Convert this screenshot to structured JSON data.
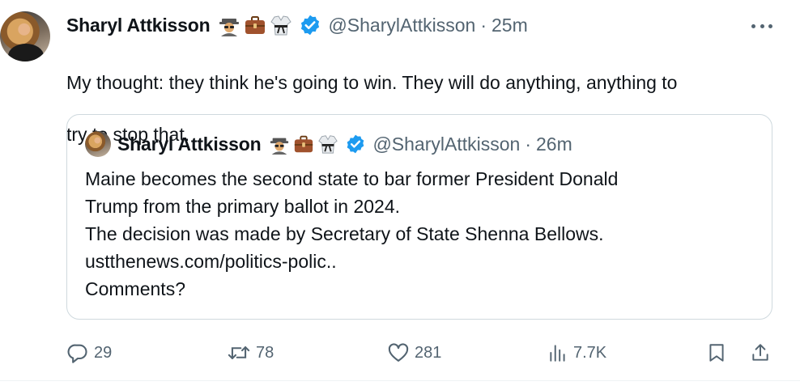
{
  "tweet": {
    "author_name": "Sharyl Attkisson",
    "badge_icons": [
      "spy-emoji-icon",
      "briefcase-emoji-icon",
      "martial-arts-uniform-emoji-icon"
    ],
    "handle": "@SharylAttkisson",
    "separator": "·",
    "time": "25m",
    "text_line1": "My thought: they think he's going to win. They will do anything, anything to",
    "text_line2": "try to stop that."
  },
  "quoted": {
    "author_name": "Sharyl Attkisson",
    "handle": "@SharylAttkisson",
    "separator": "·",
    "time": "26m",
    "lines": [
      "Maine becomes the second state to bar former President Donald",
      "Trump from the primary ballot in 2024.",
      "The decision was made by Secretary of State Shenna Bellows.",
      "ustthenews.com/politics-polic..",
      "Comments?"
    ]
  },
  "actions": {
    "replies": "29",
    "reposts": "78",
    "likes": "281",
    "views": "7.7K"
  },
  "colors": {
    "text": "#0f1419",
    "secondary": "#536471",
    "verified": "#1d9bf0",
    "border": "#cfd9de"
  }
}
